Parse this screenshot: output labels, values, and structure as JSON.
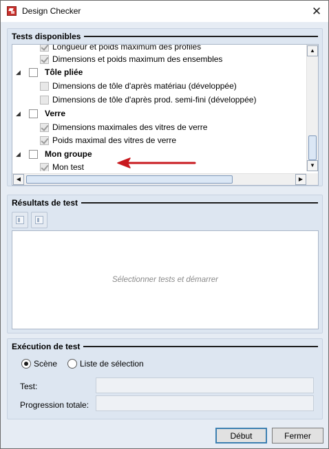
{
  "window": {
    "title": "Design Checker",
    "close_glyph": "✕",
    "icon": "design-checker-app-icon"
  },
  "tests_group": {
    "title": "Tests disponibles",
    "rows": [
      {
        "label": "Longueur et poids maximum des profilés",
        "kind": "item",
        "checked": true
      },
      {
        "label": "Dimensions et poids maximum des ensembles",
        "kind": "item",
        "checked": true
      },
      {
        "label": "Tôle pliée",
        "kind": "group",
        "checked": false
      },
      {
        "label": "Dimensions de tôle d'après matériau (développée)",
        "kind": "item",
        "checked": false
      },
      {
        "label": "Dimensions de tôle d'après prod. semi-fini (développée)",
        "kind": "item",
        "checked": false
      },
      {
        "label": "Verre",
        "kind": "group",
        "checked": false
      },
      {
        "label": "Dimensions maximales des vitres de verre",
        "kind": "item",
        "checked": true
      },
      {
        "label": "Poids maximal des vitres de verre",
        "kind": "item",
        "checked": true
      },
      {
        "label": "Mon groupe",
        "kind": "group",
        "checked": false
      },
      {
        "label": "Mon test",
        "kind": "item",
        "checked": true
      }
    ],
    "expander_glyph": "◢",
    "scroll_up_glyph": "▲",
    "scroll_down_glyph": "▼",
    "scroll_left_glyph": "◀",
    "scroll_right_glyph": "▶",
    "annotation_color": "#c8191e"
  },
  "results_group": {
    "title": "Résultats de test",
    "placeholder": "Sélectionner tests et démarrer",
    "tool_icons": [
      "export-results-icon",
      "export-selection-icon"
    ]
  },
  "execution_group": {
    "title": "Exécution de test",
    "options": [
      {
        "label": "Scène",
        "selected": true
      },
      {
        "label": "Liste de sélection",
        "selected": false
      }
    ],
    "test_label": "Test:",
    "test_value": "",
    "progress_label": "Progression totale:",
    "progress_value": ""
  },
  "buttons": {
    "start": "Début",
    "close": "Fermer"
  }
}
